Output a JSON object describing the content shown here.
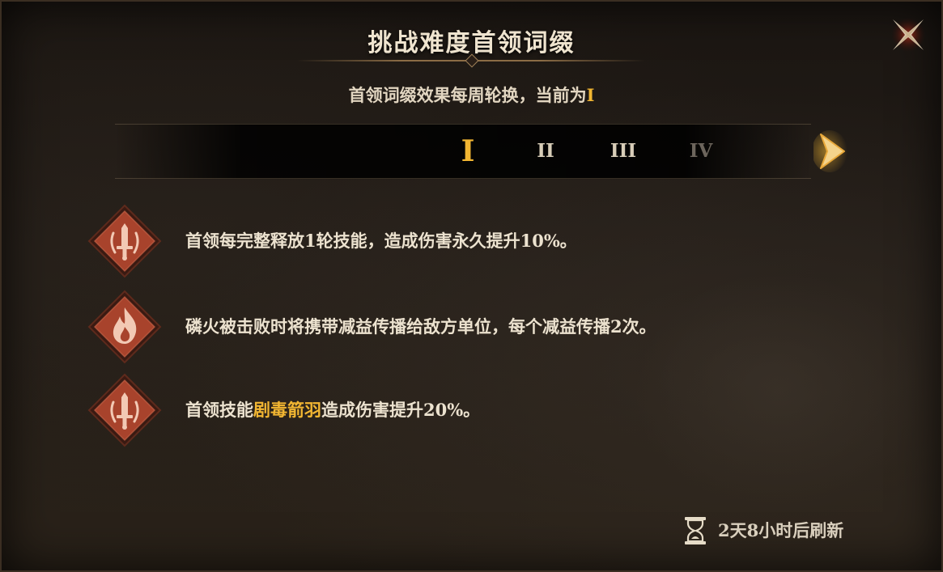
{
  "dialog": {
    "title": "挑战难度首领词缀",
    "subtitle_prefix": "首领词缀效果每周轮换，当前为",
    "subtitle_current": "I"
  },
  "tabs": [
    {
      "label": "I",
      "state": "selected"
    },
    {
      "label": "II",
      "state": "available"
    },
    {
      "label": "III",
      "state": "available"
    },
    {
      "label": "IV",
      "state": "locked"
    }
  ],
  "affixes": [
    {
      "icon": "sword-icon",
      "text": "首领每完整释放1轮技能，造成伤害永久提升10%。"
    },
    {
      "icon": "flame-icon",
      "text": "磷火被击败时将携带减益传播给敌方单位，每个减益传播2次。"
    },
    {
      "icon": "sword-icon",
      "text_before": "首领技能",
      "skill_name": "剧毒箭羽",
      "text_after": "造成伤害提升20%。"
    }
  ],
  "refresh": {
    "icon": "hourglass-icon",
    "text": "2天8小时后刷新"
  },
  "colors": {
    "accent_gold": "#f2b632",
    "text_main": "#ece2cf",
    "text_disabled": "#6c655c",
    "icon_red": "#a8432c"
  }
}
